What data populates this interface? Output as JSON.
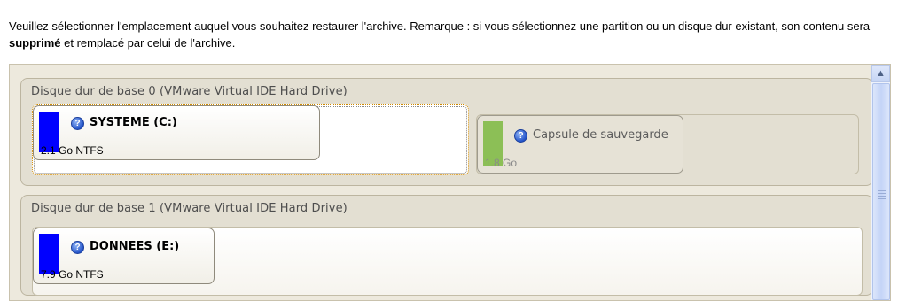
{
  "instruction": {
    "text_before": "Veuillez sélectionner l'emplacement auquel vous souhaitez restaurer l'archive. Remarque : si vous sélectionnez une partition ou un disque dur existant, son contenu sera ",
    "bold": "supprimé",
    "text_after": " et remplacé par celui de l'archive."
  },
  "colors": {
    "partition_blue": "#0000ff",
    "partition_green": "#8cbf56",
    "panel_bg": "#ede9dd",
    "selection_border": "#d08a00"
  },
  "disks": [
    {
      "title": "Disque dur de base 0 (VMware Virtual IDE Hard Drive)",
      "partitions": [
        {
          "name": "SYSTEME (C:)",
          "size": "2.1 Go NTFS",
          "icon": "help-icon",
          "color": "#0000ff",
          "selected": true
        },
        {
          "name": "Capsule de sauvegarde",
          "size": "1.8 Go",
          "icon": "help-icon",
          "color": "#8cbf56",
          "disabled": true
        }
      ]
    },
    {
      "title": "Disque dur de base 1 (VMware Virtual IDE Hard Drive)",
      "partitions": [
        {
          "name": "DONNEES (E:)",
          "size": "7.9 Go NTFS",
          "icon": "help-icon",
          "color": "#0000ff"
        }
      ]
    }
  ],
  "scrollbar": {
    "up_icon": "chevron-up-icon"
  }
}
